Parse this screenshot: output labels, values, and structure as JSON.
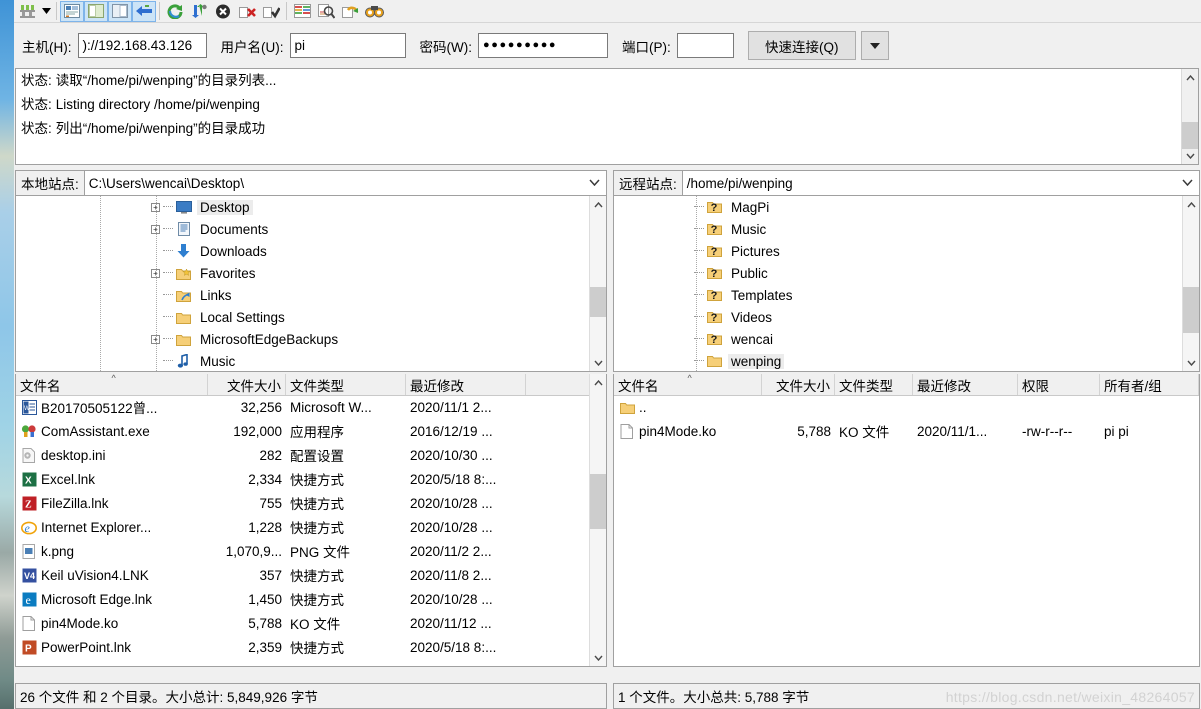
{
  "toolbar": {
    "buttons": [
      {
        "name": "site-manager",
        "icon": "site-manager-icon",
        "selected": false
      },
      {
        "name": "site-manager-dropdown",
        "icon": "chevron-down-icon",
        "selected": false
      },
      {
        "name": "toggle-message-log",
        "icon": "message-log-icon",
        "selected": true
      },
      {
        "name": "toggle-local-tree",
        "icon": "local-tree-icon",
        "selected": true
      },
      {
        "name": "toggle-remote-tree",
        "icon": "remote-tree-icon",
        "selected": true
      },
      {
        "name": "toggle-transfer-queue",
        "icon": "transfer-queue-icon",
        "selected": true
      },
      {
        "name": "refresh",
        "icon": "refresh-icon",
        "selected": false
      },
      {
        "name": "process-queue",
        "icon": "process-queue-icon",
        "selected": false
      },
      {
        "name": "cancel-operation",
        "icon": "cancel-icon",
        "selected": false
      },
      {
        "name": "disconnect",
        "icon": "disconnect-icon",
        "selected": false
      },
      {
        "name": "reconnect",
        "icon": "reconnect-icon",
        "selected": false
      },
      {
        "name": "filter-listings",
        "icon": "filter-icon",
        "selected": false
      },
      {
        "name": "directory-comparison",
        "icon": "compare-icon",
        "selected": false
      },
      {
        "name": "synchronized-browsing",
        "icon": "sync-browse-icon",
        "selected": false
      },
      {
        "name": "search-remote-files",
        "icon": "binoculars-icon",
        "selected": false
      }
    ]
  },
  "quickconnect": {
    "host_label": "主机(H):",
    "host_value": ")://192.168.43.126",
    "host_placeholder": "",
    "user_label": "用户名(U):",
    "user_value": "pi",
    "user_placeholder": "",
    "pass_label": "密码(W):",
    "pass_value": "●●●●●●●●●",
    "pass_placeholder": "",
    "port_label": "端口(P):",
    "port_value": "",
    "port_placeholder": "",
    "connect_button": "快速连接(Q)",
    "dropdown_icon": "chevron-down-icon"
  },
  "log": {
    "lines": [
      {
        "prefix": "状态:",
        "text": "读取“/home/pi/wenping”的目录列表..."
      },
      {
        "prefix": "状态:",
        "text": "Listing directory /home/pi/wenping"
      },
      {
        "prefix": "状态:",
        "text": "列出“/home/pi/wenping”的目录成功"
      }
    ]
  },
  "local": {
    "site_label": "本地站点:",
    "site_path": "C:\\Users\\wencai\\Desktop\\",
    "tree": [
      {
        "label": "Desktop",
        "icon": "desktop-icon",
        "expander": "+",
        "selected": true
      },
      {
        "label": "Documents",
        "icon": "documents-icon",
        "expander": "+",
        "selected": false
      },
      {
        "label": "Downloads",
        "icon": "downloads-icon",
        "expander": "",
        "selected": false
      },
      {
        "label": "Favorites",
        "icon": "favorites-folder-icon",
        "expander": "+",
        "selected": false
      },
      {
        "label": "Links",
        "icon": "links-folder-icon",
        "expander": "",
        "selected": false
      },
      {
        "label": "Local Settings",
        "icon": "folder-icon",
        "expander": "",
        "selected": false
      },
      {
        "label": "MicrosoftEdgeBackups",
        "icon": "folder-icon",
        "expander": "+",
        "selected": false
      },
      {
        "label": "Music",
        "icon": "music-icon",
        "expander": "",
        "selected": false
      }
    ],
    "columns": [
      "文件名",
      "文件大小",
      "文件类型",
      "最近修改"
    ],
    "sort_column": 0,
    "sort_mark": "^",
    "rows": [
      {
        "name": "B20170505122曾...",
        "size": "32,256",
        "type": "Microsoft W...",
        "modified": "2020/11/1 2...",
        "icon": "word-doc-icon"
      },
      {
        "name": "ComAssistant.exe",
        "size": "192,000",
        "type": "应用程序",
        "modified": "2016/12/19 ...",
        "icon": "exe-icon"
      },
      {
        "name": "desktop.ini",
        "size": "282",
        "type": "配置设置",
        "modified": "2020/10/30 ...",
        "icon": "ini-icon"
      },
      {
        "name": "Excel.lnk",
        "size": "2,334",
        "type": "快捷方式",
        "modified": "2020/5/18 8:...",
        "icon": "excel-icon"
      },
      {
        "name": "FileZilla.lnk",
        "size": "755",
        "type": "快捷方式",
        "modified": "2020/10/28 ...",
        "icon": "filezilla-icon"
      },
      {
        "name": "Internet  Explorer...",
        "size": "1,228",
        "type": "快捷方式",
        "modified": "2020/10/28 ...",
        "icon": "ie-icon"
      },
      {
        "name": "k.png",
        "size": "1,070,9...",
        "type": "PNG 文件",
        "modified": "2020/11/2 2...",
        "icon": "image-icon"
      },
      {
        "name": "Keil uVision4.LNK",
        "size": "357",
        "type": "快捷方式",
        "modified": "2020/11/8 2...",
        "icon": "keil-icon"
      },
      {
        "name": "Microsoft Edge.lnk",
        "size": "1,450",
        "type": "快捷方式",
        "modified": "2020/10/28 ...",
        "icon": "edge-icon"
      },
      {
        "name": "pin4Mode.ko",
        "size": "5,788",
        "type": "KO 文件",
        "modified": "2020/11/12 ...",
        "icon": "file-icon"
      },
      {
        "name": "PowerPoint.lnk",
        "size": "2,359",
        "type": "快捷方式",
        "modified": "2020/5/18 8:...",
        "icon": "powerpoint-icon"
      }
    ],
    "status": "26 个文件 和 2 个目录。大小总计: 5,849,926 字节"
  },
  "remote": {
    "site_label": "远程站点:",
    "site_path": "/home/pi/wenping",
    "tree": [
      {
        "label": "MagPi",
        "icon": "unknown-folder-icon",
        "selected": false
      },
      {
        "label": "Music",
        "icon": "unknown-folder-icon",
        "selected": false
      },
      {
        "label": "Pictures",
        "icon": "unknown-folder-icon",
        "selected": false
      },
      {
        "label": "Public",
        "icon": "unknown-folder-icon",
        "selected": false
      },
      {
        "label": "Templates",
        "icon": "unknown-folder-icon",
        "selected": false
      },
      {
        "label": "Videos",
        "icon": "unknown-folder-icon",
        "selected": false
      },
      {
        "label": "wencai",
        "icon": "unknown-folder-icon",
        "selected": false
      },
      {
        "label": "wenping",
        "icon": "folder-icon",
        "selected": true
      }
    ],
    "columns": [
      "文件名",
      "文件大小",
      "文件类型",
      "最近修改",
      "权限",
      "所有者/组"
    ],
    "sort_column": 0,
    "sort_mark": "^",
    "rows": [
      {
        "name": "..",
        "size": "",
        "type": "",
        "modified": "",
        "perms": "",
        "owner": "",
        "icon": "folder-icon"
      },
      {
        "name": "pin4Mode.ko",
        "size": "5,788",
        "type": "KO 文件",
        "modified": "2020/11/1...",
        "perms": "-rw-r--r--",
        "owner": "pi pi",
        "icon": "file-icon"
      }
    ],
    "status": "1 个文件。大小总共: 5,788 字节"
  },
  "watermark": "https://blog.csdn.net/weixin_48264057",
  "colors": {
    "selection": "#cce4f7",
    "selection_border": "#7eb4ea",
    "window_bg": "#f0f0f0",
    "panel_border": "#a0a0a0",
    "tree_selected_bg": "#ececec"
  }
}
